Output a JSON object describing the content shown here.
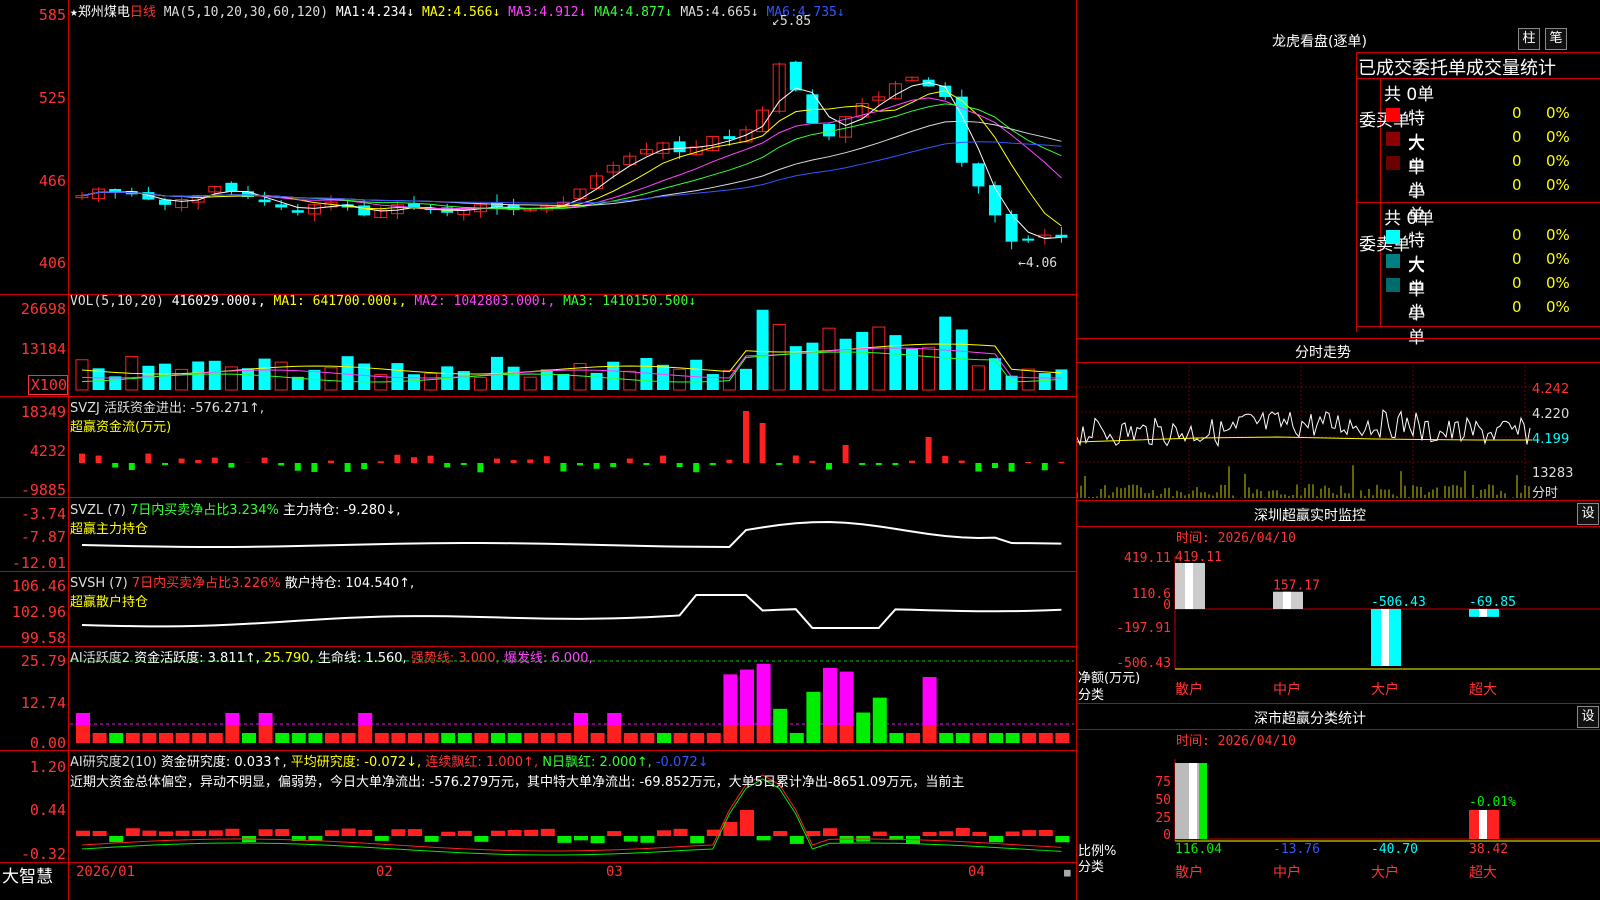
{
  "stock": {
    "star": "★",
    "name": "郑州煤电",
    "period": "日线",
    "ma_label": "MA(5,10,20,30,60,120)",
    "ma_values": [
      {
        "label": "MA1:",
        "value": "4.234↓",
        "color": "#ffffff"
      },
      {
        "label": "MA2:",
        "value": "4.566↓",
        "color": "#ffff00"
      },
      {
        "label": "MA3:",
        "value": "4.912↓",
        "color": "#ff44ff"
      },
      {
        "label": "MA4:",
        "value": "4.877↓",
        "color": "#33ff33"
      },
      {
        "label": "MA5:",
        "value": "4.665↓",
        "color": "#dddddd"
      },
      {
        "label": "MA6:",
        "value": "4.735↓",
        "color": "#3355ff"
      }
    ],
    "high_label": "5.85",
    "low_label": "4.06",
    "price_axis": [
      "585",
      "525",
      "466",
      "406"
    ]
  },
  "vol": {
    "title": "VOL(5,10,20)",
    "value": "416029.000↓,",
    "ma1": "MA1: 641700.000↓,",
    "ma2": "MA2: 1042803.000↓,",
    "ma3": "MA3: 1410150.500↓",
    "axis": [
      "26698",
      "13184",
      "X100"
    ]
  },
  "svzj": {
    "line1": "SVZJ  活跃资金进出: -576.271↑,",
    "line2": "超赢资金流(万元)",
    "axis": [
      "18349",
      "4232",
      "-9885"
    ]
  },
  "svzl": {
    "prefix": "SVZL (7)",
    "ratio": "7日内买卖净占比3.234%",
    "hold": "主力持仓: -9.280↓,",
    "line2": "超赢主力持仓",
    "axis": [
      "-3.74",
      "-7.87",
      "-12.01"
    ]
  },
  "svsh": {
    "prefix": "SVSH (7)",
    "ratio": "7日内买卖净占比3.226%",
    "hold": "散户持仓: 104.540↑,",
    "line2": "超赢散户持仓",
    "axis": [
      "106.46",
      "102.96",
      "99.58"
    ]
  },
  "ai1": {
    "title": "AI活跃度2",
    "active": "资金活跃度: 3.811↑,",
    "v2": "25.790,",
    "life": "生命线: 1.560,",
    "strong": "强势线: 3.000,",
    "burst": "爆发线: 6.000,",
    "axis": [
      "25.79",
      "12.74",
      "0.00"
    ]
  },
  "ai2": {
    "title": "AI研究度2(10)",
    "research": "资金研究度: 0.033↑,",
    "avg": "平均研究度: -0.072↓,",
    "cont": "连续飘红: 1.000↑,",
    "nday": "N日飘红: 2.000↑,",
    "last": "-0.072↓",
    "commentary": "近期大资金总体偏空，异动不明显，偏弱势，今日大单净流出: -576.279万元，其中特大单净流出: -69.852万元，大单5日累计净出-8651.09万元，当前主",
    "axis": [
      "1.20",
      "0.44",
      "-0.32"
    ]
  },
  "time_axis": [
    "2026/01",
    "02",
    "03",
    "04"
  ],
  "brand": "大智慧",
  "right": {
    "dragon_title": "龙虎看盘(逐单)",
    "btn_zhu": "柱",
    "btn_bi": "笔",
    "stats_header": "已成交委托单成交量统计",
    "buy_label": "委买单",
    "sell_label": "委卖单",
    "buy_total": "共 0单",
    "sell_total": "共 0单",
    "buy_rows": [
      {
        "label": "特大",
        "count": "0",
        "pct": "0%",
        "color": "#ff0000"
      },
      {
        "label": "大单",
        "count": "0",
        "pct": "0%",
        "color": "#8b0000"
      },
      {
        "label": "中单",
        "count": "0",
        "pct": "0%",
        "color": "#6b0000"
      },
      {
        "label": "小单",
        "count": "0",
        "pct": "0%",
        "color": ""
      }
    ],
    "sell_rows": [
      {
        "label": "特大",
        "count": "0",
        "pct": "0%",
        "color": "#00ffff"
      },
      {
        "label": "大单",
        "count": "0",
        "pct": "0%",
        "color": "#008080"
      },
      {
        "label": "中单",
        "count": "0",
        "pct": "0%",
        "color": "#006b6b"
      },
      {
        "label": "小单",
        "count": "0",
        "pct": "0%",
        "color": ""
      }
    ],
    "intraday_title": "分时走势",
    "intraday_axis": [
      "4.242",
      "4.220",
      "4.199",
      "13283",
      "分时"
    ],
    "monitor_title": "深圳超赢实时监控",
    "monitor_time": "时间: 2026/04/10",
    "monitor_axis": [
      "419.11",
      "110.6",
      "0",
      "-197.91",
      "-506.43"
    ],
    "monitor_y_unit": "净额(万元)",
    "monitor_x_unit": "分类",
    "categories": [
      "散户",
      "中户",
      "大户",
      "超大"
    ],
    "monitor_values": [
      419.11,
      157.17,
      -506.43,
      -69.85
    ],
    "monitor_labels": [
      "419.11",
      "157.17",
      "-506.43",
      "-69.85"
    ],
    "classify_title": "深市超赢分类统计",
    "classify_time": "时间: 2026/04/10",
    "classify_axis": [
      "75",
      "50",
      "25",
      "0"
    ],
    "classify_y_unit": "比例%",
    "classify_x_unit": "分类",
    "classify_values": [
      116.04,
      -13.76,
      -40.7,
      38.42
    ],
    "classify_labels": [
      "116.04",
      "-13.76",
      "-40.70",
      "38.42"
    ],
    "classify_top_label": "-0.01%",
    "settings_label": "设"
  },
  "colors": {
    "up": "#ff2020",
    "down": "#00ffff",
    "green": "#00ee00",
    "magenta": "#ff00ff",
    "grid": "#cc0000"
  }
}
